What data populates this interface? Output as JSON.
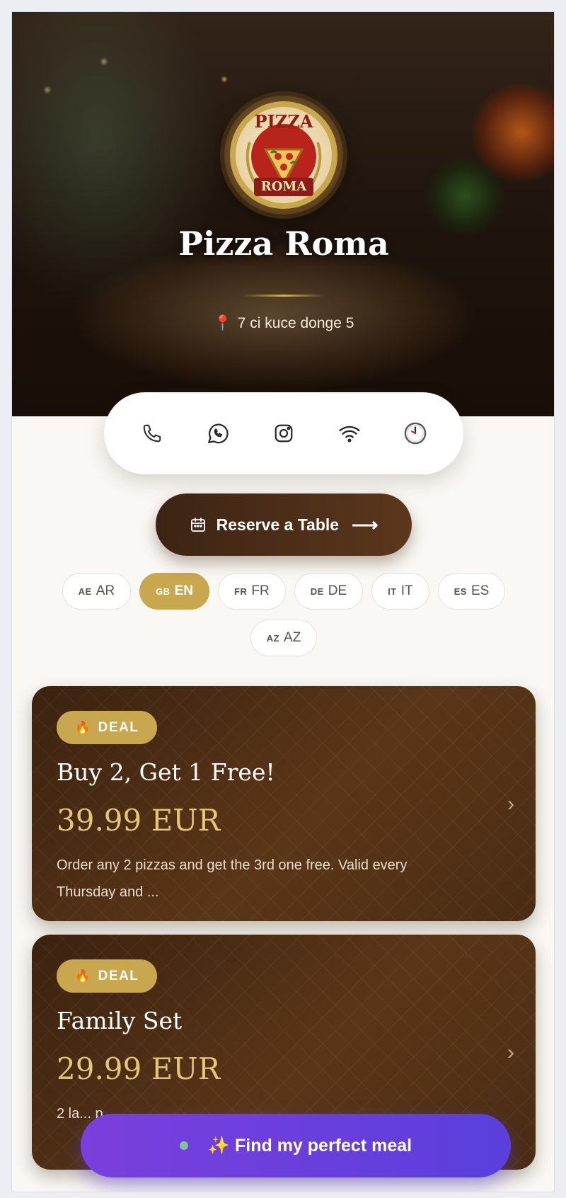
{
  "restaurant": {
    "logo_top_text": "PIZZA",
    "logo_bottom_text": "ROMA",
    "name": "Pizza Roma",
    "address": "7 ci kuce donge 5"
  },
  "actions": [
    {
      "icon": "phone-icon"
    },
    {
      "icon": "whatsapp-icon"
    },
    {
      "icon": "instagram-icon"
    },
    {
      "icon": "wifi-icon"
    },
    {
      "icon": "clock-icon"
    }
  ],
  "reserve": {
    "label": "Reserve a Table",
    "arrow": "⟶"
  },
  "languages": [
    {
      "flag": "AE",
      "code": "AR"
    },
    {
      "flag": "GB",
      "code": "EN",
      "active": true
    },
    {
      "flag": "FR",
      "code": "FR"
    },
    {
      "flag": "DE",
      "code": "DE"
    },
    {
      "flag": "IT",
      "code": "IT"
    },
    {
      "flag": "ES",
      "code": "ES"
    },
    {
      "flag": "AZ",
      "code": "AZ"
    }
  ],
  "deals": [
    {
      "badge": "DEAL",
      "title": "Buy 2, Get 1 Free!",
      "price": "39.99 EUR",
      "description": "Order any 2 pizzas and get the 3rd one free. Valid every Thursday and ..."
    },
    {
      "badge": "DEAL",
      "title": "Family Set",
      "price": "29.99 EUR",
      "description": "2 la... p..."
    }
  ],
  "cta": {
    "label": "✨ Find my perfect meal"
  },
  "colors": {
    "gold": "#c9a74f",
    "dark_brown": "#3c2414",
    "purple": "#6a3fdc",
    "cream": "#faf8f4"
  }
}
